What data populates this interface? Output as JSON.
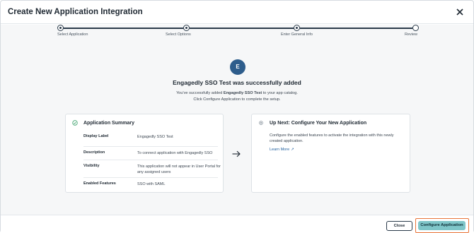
{
  "modal": {
    "title": "Create New Application Integration"
  },
  "stepper": {
    "steps": [
      {
        "label": "Select Application"
      },
      {
        "label": "Select Options"
      },
      {
        "label": "Enter General Info"
      },
      {
        "label": "Review"
      }
    ]
  },
  "success": {
    "avatar_letter": "E",
    "title": "Engagedly SSO Test was successfully added",
    "sub_prefix": "You've successfully added ",
    "sub_app": "Engagedly SSO Test",
    "sub_suffix": " to your app catalog.",
    "sub_line2": "Click Configure Application to complete the setup."
  },
  "summary": {
    "title": "Application Summary",
    "rows": [
      {
        "key": "Display Label",
        "value": "Engagedly SSO Test"
      },
      {
        "key": "Description",
        "value": "To connect application with Engagedly SSO"
      },
      {
        "key": "Visibility",
        "value": "This application will not appear in User Portal for any assigned users"
      },
      {
        "key": "Enabled Features",
        "value": "SSO with SAML"
      }
    ]
  },
  "next": {
    "title": "Up Next: Configure Your New Application",
    "description": "Configure the enabled features to activate the integration with this newly created application.",
    "learn_more": "Learn More"
  },
  "footer": {
    "close_label": "Close",
    "configure_label": "Configure Application"
  },
  "colors": {
    "accent": "#2e5d8c",
    "primary_button": "#7fc6c9",
    "highlight_border": "#e8753a",
    "link": "#1f5f9e"
  }
}
